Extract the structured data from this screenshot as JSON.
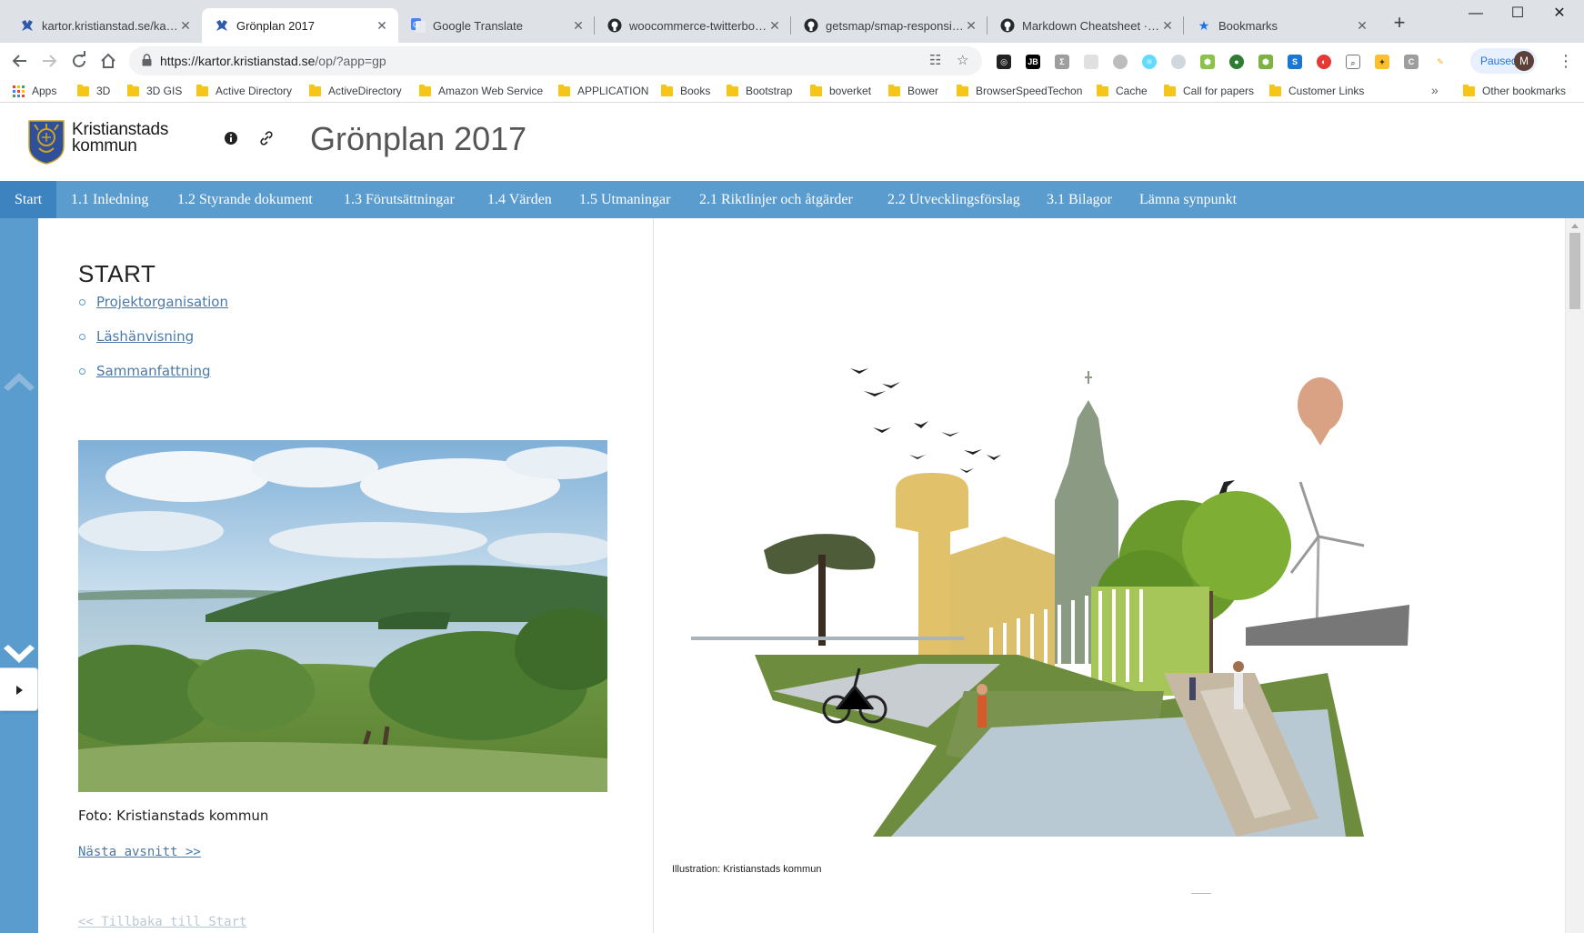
{
  "browser": {
    "tabs": [
      {
        "label": "kartor.kristianstad.se/kartor.k",
        "active": false,
        "favicon": "kristianstad-crest-icon"
      },
      {
        "label": "Grönplan 2017",
        "active": true,
        "favicon": "kristianstad-crest-icon"
      },
      {
        "label": "Google Translate",
        "active": false,
        "favicon": "google-translate-icon"
      },
      {
        "label": "woocommerce-twitterbootst",
        "active": false,
        "favicon": "github-icon"
      },
      {
        "label": "getsmap/smap-responsive: /",
        "active": false,
        "favicon": "github-icon"
      },
      {
        "label": "Markdown Cheatsheet · ada",
        "active": false,
        "favicon": "github-icon"
      },
      {
        "label": "Bookmarks",
        "active": false,
        "favicon": "star-icon"
      }
    ],
    "url_host": "https://kartor.kristianstad.se",
    "url_rest": "/op/?app=gp",
    "paused_label": "Paused",
    "avatar_initial": "M",
    "bookmarks": [
      {
        "label": "Apps"
      },
      {
        "label": "3D"
      },
      {
        "label": "3D GIS"
      },
      {
        "label": "Active Directory"
      },
      {
        "label": "ActiveDirectory"
      },
      {
        "label": "Amazon Web Service"
      },
      {
        "label": "APPLICATION"
      },
      {
        "label": "Books"
      },
      {
        "label": "Bootstrap"
      },
      {
        "label": "boverket"
      },
      {
        "label": "Bower"
      },
      {
        "label": "BrowserSpeedTechon"
      },
      {
        "label": "Cache"
      },
      {
        "label": "Call for papers"
      },
      {
        "label": "Customer Links"
      }
    ],
    "other_bookmarks": "Other bookmarks"
  },
  "header": {
    "logo_line1": "Kristianstads",
    "logo_line2": "kommun",
    "app_title": "Grönplan 2017"
  },
  "nav": {
    "items": [
      {
        "label": "Start",
        "active": true
      },
      {
        "label": "1.1 Inledning"
      },
      {
        "label": "1.2 Styrande dokument"
      },
      {
        "label": "1.3 Förutsättningar"
      },
      {
        "label": "1.4 Värden"
      },
      {
        "label": "1.5 Utmaningar"
      },
      {
        "label": "2.1 Riktlinjer och åtgärder"
      },
      {
        "label": "2.2 Utvecklingsförslag"
      },
      {
        "label": "3.1 Bilagor"
      },
      {
        "label": "Lämna synpunkt"
      }
    ]
  },
  "content": {
    "heading": "START",
    "toc": [
      "Projektorganisation",
      "Läshänvisning",
      "Sammanfattning"
    ],
    "photo_caption": "Foto: Kristianstads kommun",
    "next_link": "Nästa avsnitt >>",
    "back_link": "<< Tillbaka till Start",
    "illustration_caption": "Illustration: Kristianstads kommun"
  },
  "colors": {
    "nav_bg": "#5b9ccf",
    "nav_active": "#3d83bf",
    "link": "#4b7aa8"
  }
}
